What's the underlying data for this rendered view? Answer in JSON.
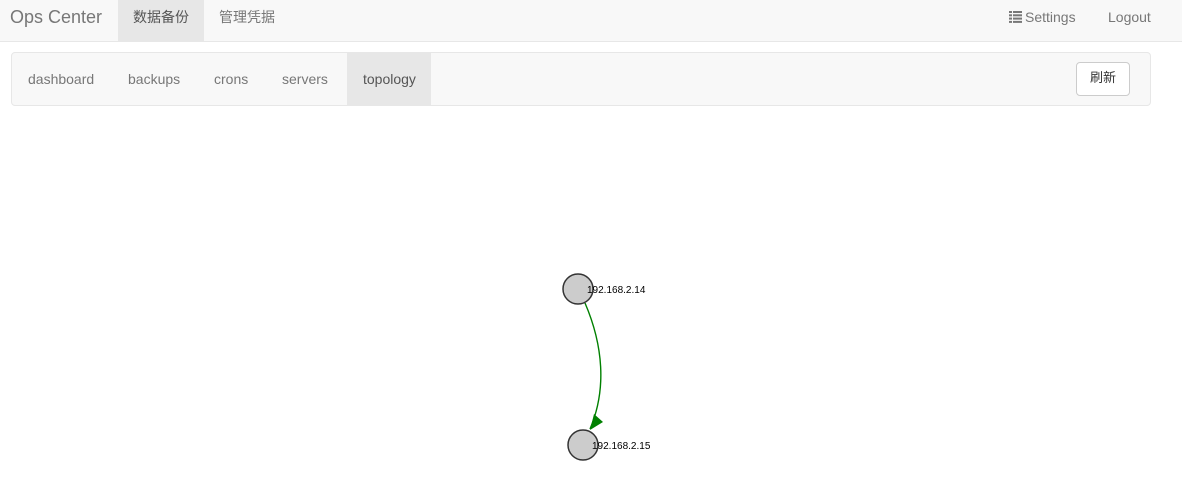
{
  "app": {
    "brand": "Ops Center"
  },
  "topnav": {
    "items": [
      {
        "label": "数据备份",
        "active": true
      },
      {
        "label": "管理凭据",
        "active": false
      }
    ],
    "settings_label": "Settings",
    "logout_label": "Logout"
  },
  "subnav": {
    "tabs": [
      {
        "label": "dashboard",
        "active": false
      },
      {
        "label": "backups",
        "active": false
      },
      {
        "label": "crons",
        "active": false
      },
      {
        "label": "servers",
        "active": false
      },
      {
        "label": "topology",
        "active": true
      }
    ],
    "refresh_label": "刷新"
  },
  "topology": {
    "nodes": [
      {
        "id": "n1",
        "label": "192.168.2.14"
      },
      {
        "id": "n2",
        "label": "192.168.2.15"
      }
    ],
    "edges": [
      {
        "from": "n1",
        "to": "n2",
        "color": "#008000"
      }
    ],
    "node_fill": "#cccccc",
    "node_stroke": "#333333"
  }
}
